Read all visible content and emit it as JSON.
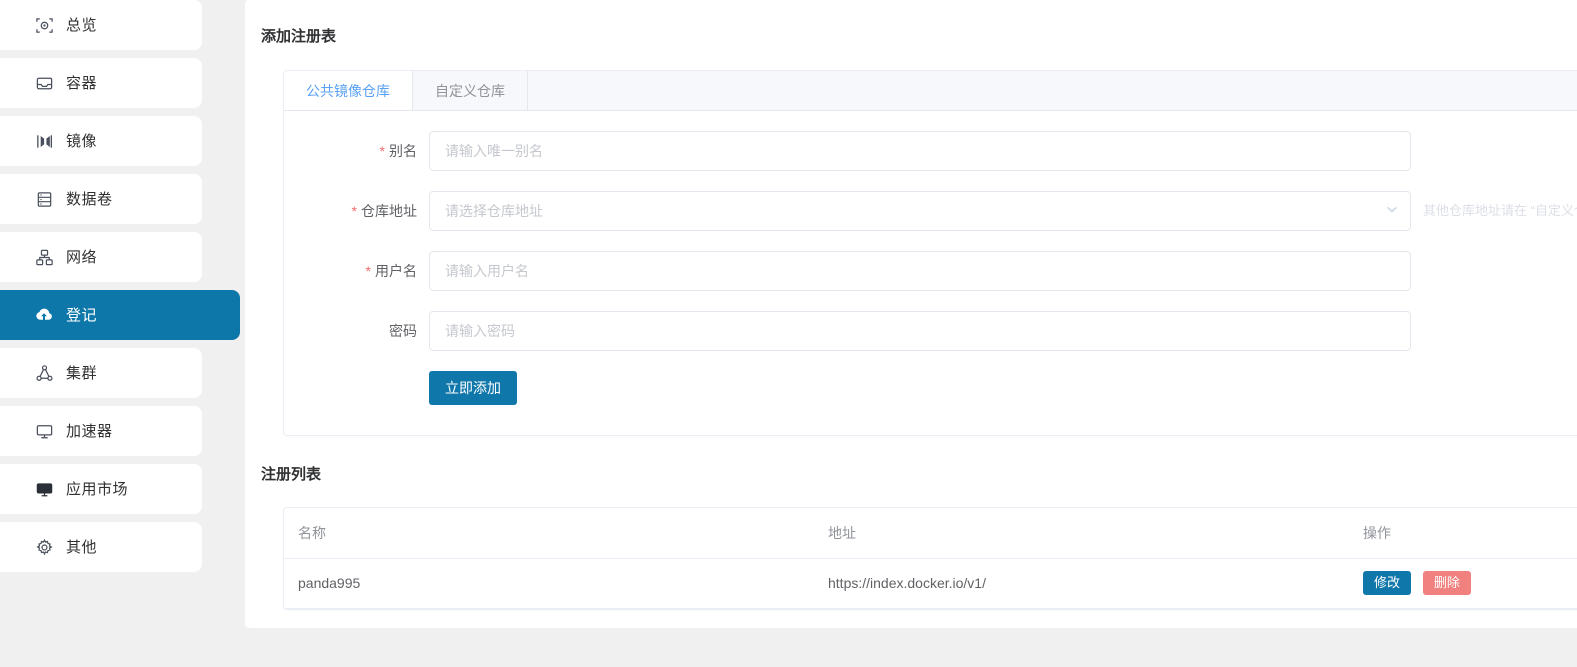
{
  "theme": {
    "page_bg": "#f0f0f0",
    "accent": "#0e77aa",
    "primary_button": "#1077ab",
    "danger_button": "#f0817e",
    "active_tab_text": "#5aa2f5",
    "required_star": "#f56c6c"
  },
  "sidebar": {
    "items": [
      {
        "label": "总览",
        "icon": "overview-focus-icon",
        "active": false
      },
      {
        "label": "容器",
        "icon": "inbox-container-icon",
        "active": false
      },
      {
        "label": "镜像",
        "icon": "image-layers-icon",
        "active": false
      },
      {
        "label": "数据卷",
        "icon": "database-volume-icon",
        "active": false
      },
      {
        "label": "网络",
        "icon": "network-nodes-icon",
        "active": false
      },
      {
        "label": "登记",
        "icon": "cloud-upload-icon",
        "active": true
      },
      {
        "label": "集群",
        "icon": "cluster-share-icon",
        "active": false
      },
      {
        "label": "加速器",
        "icon": "monitor-icon",
        "active": false
      },
      {
        "label": "应用市场",
        "icon": "app-store-icon",
        "active": false
      },
      {
        "label": "其他",
        "icon": "gear-icon",
        "active": false
      }
    ]
  },
  "add_registry": {
    "section_title": "添加注册表",
    "tabs": [
      {
        "label": "公共镜像仓库",
        "active": true
      },
      {
        "label": "自定义仓库",
        "active": false
      }
    ],
    "fields": [
      {
        "label": "别名",
        "required": true,
        "type": "text",
        "value": "",
        "placeholder": "请输入唯一别名",
        "hint": ""
      },
      {
        "label": "仓库地址",
        "required": true,
        "type": "select",
        "value": "",
        "placeholder": "请选择仓库地址",
        "hint": "其他仓库地址请在 “自定义仓库",
        "chevron_icon": "chevron-down-icon"
      },
      {
        "label": "用户名",
        "required": true,
        "type": "text",
        "value": "",
        "placeholder": "请输入用户名",
        "hint": ""
      },
      {
        "label": "密码",
        "required": false,
        "type": "password",
        "value": "",
        "placeholder": "请输入密码",
        "hint": ""
      }
    ],
    "submit_label": "立即添加"
  },
  "registry_list": {
    "section_title": "注册列表",
    "columns": [
      "名称",
      "地址",
      "操作"
    ],
    "rows": [
      {
        "name": "panda995",
        "address": "https://index.docker.io/v1/",
        "actions": [
          {
            "label": "修改",
            "style": "edit"
          },
          {
            "label": "删除",
            "style": "del"
          }
        ]
      }
    ]
  }
}
